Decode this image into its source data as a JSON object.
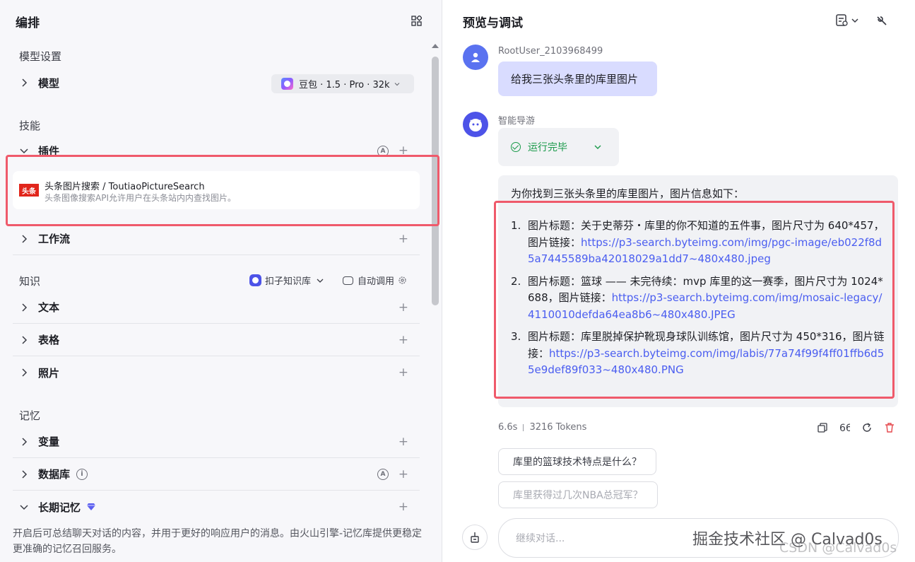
{
  "left": {
    "title": "编排",
    "model_settings": {
      "section": "模型设置",
      "model_label": "模型",
      "model_value": "豆包 · 1.5 · Pro · 32k"
    },
    "skills": {
      "section": "技能",
      "plugins_label": "插件",
      "plugin": {
        "logo_text": "头条",
        "name": "头条图片搜索 / ToutiaoPictureSearch",
        "desc": "头条图像搜索API允许用户在头条站内内查找图片。"
      },
      "workflow_label": "工作流"
    },
    "knowledge": {
      "section": "知识",
      "kb_select": "扣子知识库",
      "auto_call": "自动调用",
      "items": [
        "文本",
        "表格",
        "照片"
      ]
    },
    "memory": {
      "section": "记忆",
      "variable_label": "变量",
      "database_label": "数据库",
      "ltm_label": "长期记忆",
      "ltm_desc": "开启后可总结聊天对话的内容，并用于更好的响应用户的消息。由火山引擎-记忆库提供更稳定更准确的记忆召回服务。"
    }
  },
  "right": {
    "title": "预览与调试",
    "user_name": "RootUser_2103968499",
    "user_message": "给我三张头条里的库里图片",
    "bot_name": "智能导游",
    "status": "运行完毕",
    "answer_intro": "为你找到三张头条里的库里图片，图片信息如下：",
    "results": [
      {
        "num": "1.",
        "text": "图片标题：关于史蒂芬・库里的你不知道的五件事，图片尺寸为 640*457，图片链接：",
        "link": "https://p3-search.byteimg.com/img/pgc-image/eb022f8d5a7445589ba42018029a1dd7~480x480.jpeg"
      },
      {
        "num": "2.",
        "text": "图片标题：篮球 —— 未完待续：mvp 库里的这一赛季，图片尺寸为 1024*688，图片链接：",
        "link": "https://p3-search.byteimg.com/img/mosaic-legacy/4110010defda64ea8b6~480x480.JPEG"
      },
      {
        "num": "3.",
        "text": "图片标题：库里脱掉保护靴现身球队训练馆，图片尺寸为 450*316，图片链接：",
        "link": "https://p3-search.byteimg.com/img/labis/77a74f99f4ff01ffb6d55e9def89f033~480x480.PNG"
      }
    ],
    "meta_time": "6.6s",
    "meta_tokens": "3216 Tokens",
    "suggestions": [
      "库里的篮球技术特点是什么？",
      "库里获得过几次NBA总冠军？"
    ],
    "input_placeholder": "继续对话...",
    "watermark_main": "掘金技术社区 @ Calvad0s",
    "watermark_csdn": "CSDN @Calvad0s"
  },
  "colors": {
    "accent": "#4d53e8",
    "highlight_border": "#ef5a6b",
    "success": "#1a9a4a",
    "link": "#4a5df0"
  }
}
